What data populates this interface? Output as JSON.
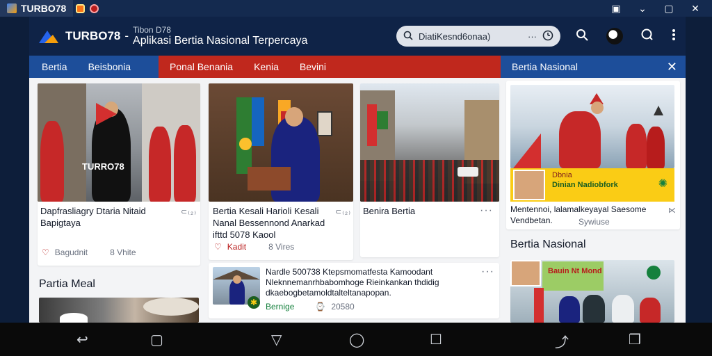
{
  "system": {
    "tab_title": "TURBO78",
    "icons": [
      "app-icon",
      "square-orange-icon",
      "red-circle-icon",
      "image-icon",
      "chevron-down-icon",
      "restore-icon",
      "close-icon"
    ],
    "right_glyphs": [
      "▣",
      "⌄",
      "▢",
      "✕"
    ]
  },
  "header": {
    "brand": "TURBO78",
    "sep": "-",
    "sub_top": "Tibon D78",
    "sub_main": "Aplikasi Bertia Nasional Terpercaya",
    "search_placeholder": "DiatiKesnd6onaa)",
    "search_more": "···"
  },
  "nav": {
    "left": [
      "Bertia",
      "Beisbonia"
    ],
    "mid": [
      "Ponal Benania",
      "Kenia",
      "Bevini"
    ],
    "right_label": "Bertia Nasional",
    "close": "✕"
  },
  "cards": [
    {
      "title": "Dapfrasliagry Dtaria Nitaid Bapigtaya",
      "more": "⊂₍₂₎",
      "meta_icon": "♡",
      "meta_a": "Bagudnit",
      "meta_b": "8 Vhite",
      "overlay": "TURRO78"
    },
    {
      "title": "Bertia Kesali Harioli Kesali Nanal Bessennond Anarkad ifttd 5078 Kaool",
      "more": "⊂₍₂₎",
      "meta_icon": "♡",
      "meta_a": "Kadit",
      "meta_b": "8 Vires"
    },
    {
      "title": "Benira Bertia",
      "more": "···"
    },
    {
      "title": "Nardle 500738 Ktepsmomatfesta Kamoodant Nleknnemanrhbabomhoge Rieinkankan thdidig dkaebogbetamoldtalteltanapopan.",
      "more": "···",
      "meta_a": "Bernige",
      "meta_b": "20580"
    }
  ],
  "section_left": "Partia Meal",
  "right_panel": {
    "card_title": "Mentennoi, lalamalkeyayal Saesome Vendbetan.",
    "card_meta": "Sywiuse",
    "banner_top": "Dbnia",
    "banner_main": "Dinian Nadiobfork",
    "section": "Bertia Nasional",
    "banner2": "Bauin Nt Mond"
  },
  "bottom": {
    "glyphs": [
      "↩",
      "▢",
      "▽",
      "◯",
      "☐",
      "⤴",
      "❒"
    ]
  },
  "colors": {
    "brand_navy": "#0f2347",
    "nav_blue": "#1d4e9a",
    "nav_red": "#c0281d",
    "accent_yellow": "#facc15"
  }
}
